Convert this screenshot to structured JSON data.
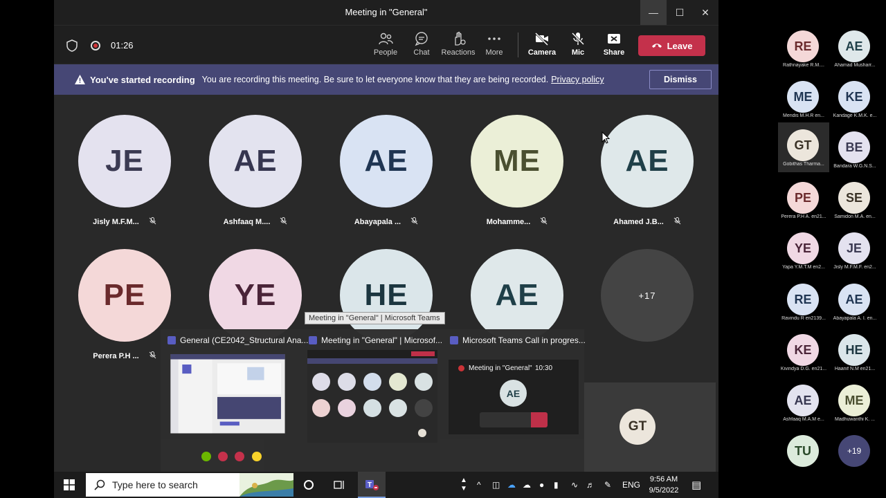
{
  "window": {
    "title": "Meeting in \"General\""
  },
  "toolbar": {
    "timer": "01:26",
    "people": "People",
    "chat": "Chat",
    "reactions": "Reactions",
    "more": "More",
    "camera": "Camera",
    "mic": "Mic",
    "share": "Share",
    "leave": "Leave"
  },
  "banner": {
    "title": "You've started recording",
    "message": "You are recording this meeting. Be sure to let everyone know that they are being recorded.",
    "link": "Privacy policy",
    "dismiss": "Dismiss"
  },
  "grid": [
    {
      "initials": "JE",
      "name": "Jisly M.F.M...",
      "bg": "#e4e2ef",
      "fg": "#3b3a52"
    },
    {
      "initials": "AE",
      "name": "Ashfaaq M....",
      "bg": "#e3e3ef",
      "fg": "#363650"
    },
    {
      "initials": "AE",
      "name": "Abayapala ...",
      "bg": "#d9e3f3",
      "fg": "#1f3552"
    },
    {
      "initials": "ME",
      "name": "Mohamme...",
      "bg": "#ebefd7",
      "fg": "#4a4f30"
    },
    {
      "initials": "AE",
      "name": "Ahamed J.B...",
      "bg": "#dfe8ea",
      "fg": "#1f3f48"
    },
    {
      "initials": "PE",
      "name": "Perera P.H ...",
      "bg": "#f4d8d8",
      "fg": "#6a2a2c"
    },
    {
      "initials": "YE",
      "name": "",
      "bg": "#f0d8e4",
      "fg": "#4a2438"
    },
    {
      "initials": "HE",
      "name": "",
      "bg": "#dbe6ea",
      "fg": "#1c3640"
    },
    {
      "initials": "AE",
      "name": "",
      "bg": "#dfe8ea",
      "fg": "#1f3f48"
    }
  ],
  "more_count": "+17",
  "self_initials": "GT",
  "side": [
    {
      "initials": "RE",
      "name": "Rathnayake R.M....",
      "bg": "#f4d8d8",
      "fg": "#6a2a2c"
    },
    {
      "initials": "AE",
      "name": "Ahamad Musharr...",
      "bg": "#dfe8ea",
      "fg": "#1f3f48"
    },
    {
      "initials": "ME",
      "name": "Mendis M.H.R en...",
      "bg": "#d9e3f3",
      "fg": "#1f3552"
    },
    {
      "initials": "KE",
      "name": "Kandage K.M.K. e...",
      "bg": "#d9e3f3",
      "fg": "#1f3552"
    },
    {
      "initials": "GT",
      "name": "Gobithas Tharma...",
      "bg": "#ece6dc",
      "fg": "#3a3226"
    },
    {
      "initials": "BE",
      "name": "Bandara W.G.N.S...",
      "bg": "#e4e2ef",
      "fg": "#3b3a52"
    },
    {
      "initials": "PE",
      "name": "Perera P.H A. en21...",
      "bg": "#f4d8d8",
      "fg": "#6a2a2c"
    },
    {
      "initials": "SE",
      "name": "Samidon M.A. en...",
      "bg": "#ece6dc",
      "fg": "#3a3226"
    },
    {
      "initials": "YE",
      "name": "Yapa Y.M.T.M en2...",
      "bg": "#f0d8e4",
      "fg": "#4a2438"
    },
    {
      "initials": "JE",
      "name": "Jisly M.F.M.F. en2...",
      "bg": "#e4e2ef",
      "fg": "#3b3a52"
    },
    {
      "initials": "RE",
      "name": "Ravindu R en2139...",
      "bg": "#d9e3f3",
      "fg": "#1f3552"
    },
    {
      "initials": "AE",
      "name": "Abayapala A. I. en...",
      "bg": "#d9e3f3",
      "fg": "#1f3552"
    },
    {
      "initials": "KE",
      "name": "Kivindya D.G. en21...",
      "bg": "#f0d8e4",
      "fg": "#4a2438"
    },
    {
      "initials": "HE",
      "name": "Haanif N.M en21...",
      "bg": "#dbe6ea",
      "fg": "#1c3640"
    },
    {
      "initials": "AE",
      "name": "Ashfaaq M.A.M e...",
      "bg": "#e3e3ef",
      "fg": "#363650"
    },
    {
      "initials": "ME",
      "name": "Madhuwanthi K. ...",
      "bg": "#ebefd7",
      "fg": "#4a4f30"
    },
    {
      "initials": "TU",
      "name": "",
      "bg": "#dcebdc",
      "fg": "#2a4a2a"
    },
    {
      "initials": "+19",
      "name": "",
      "bg": "#464775",
      "fg": "#ffffff"
    }
  ],
  "previews": {
    "tooltip": "Meeting in \"General\" | Microsoft Teams",
    "items": [
      {
        "title": "General (CE2042_Structural Ana..."
      },
      {
        "title": "Meeting in \"General\" | Microsof..."
      },
      {
        "title": "Microsoft Teams Call in progres..."
      }
    ],
    "call_title": "Meeting in \"General\"",
    "call_time": "10:30",
    "call_initials": "AE"
  },
  "taskbar": {
    "search_placeholder": "Type here to search",
    "lang": "ENG",
    "time": "9:56 AM",
    "date": "9/5/2022"
  },
  "colors": {
    "accent": "#464775",
    "leave": "#c4314b",
    "recording": "#d13438"
  }
}
